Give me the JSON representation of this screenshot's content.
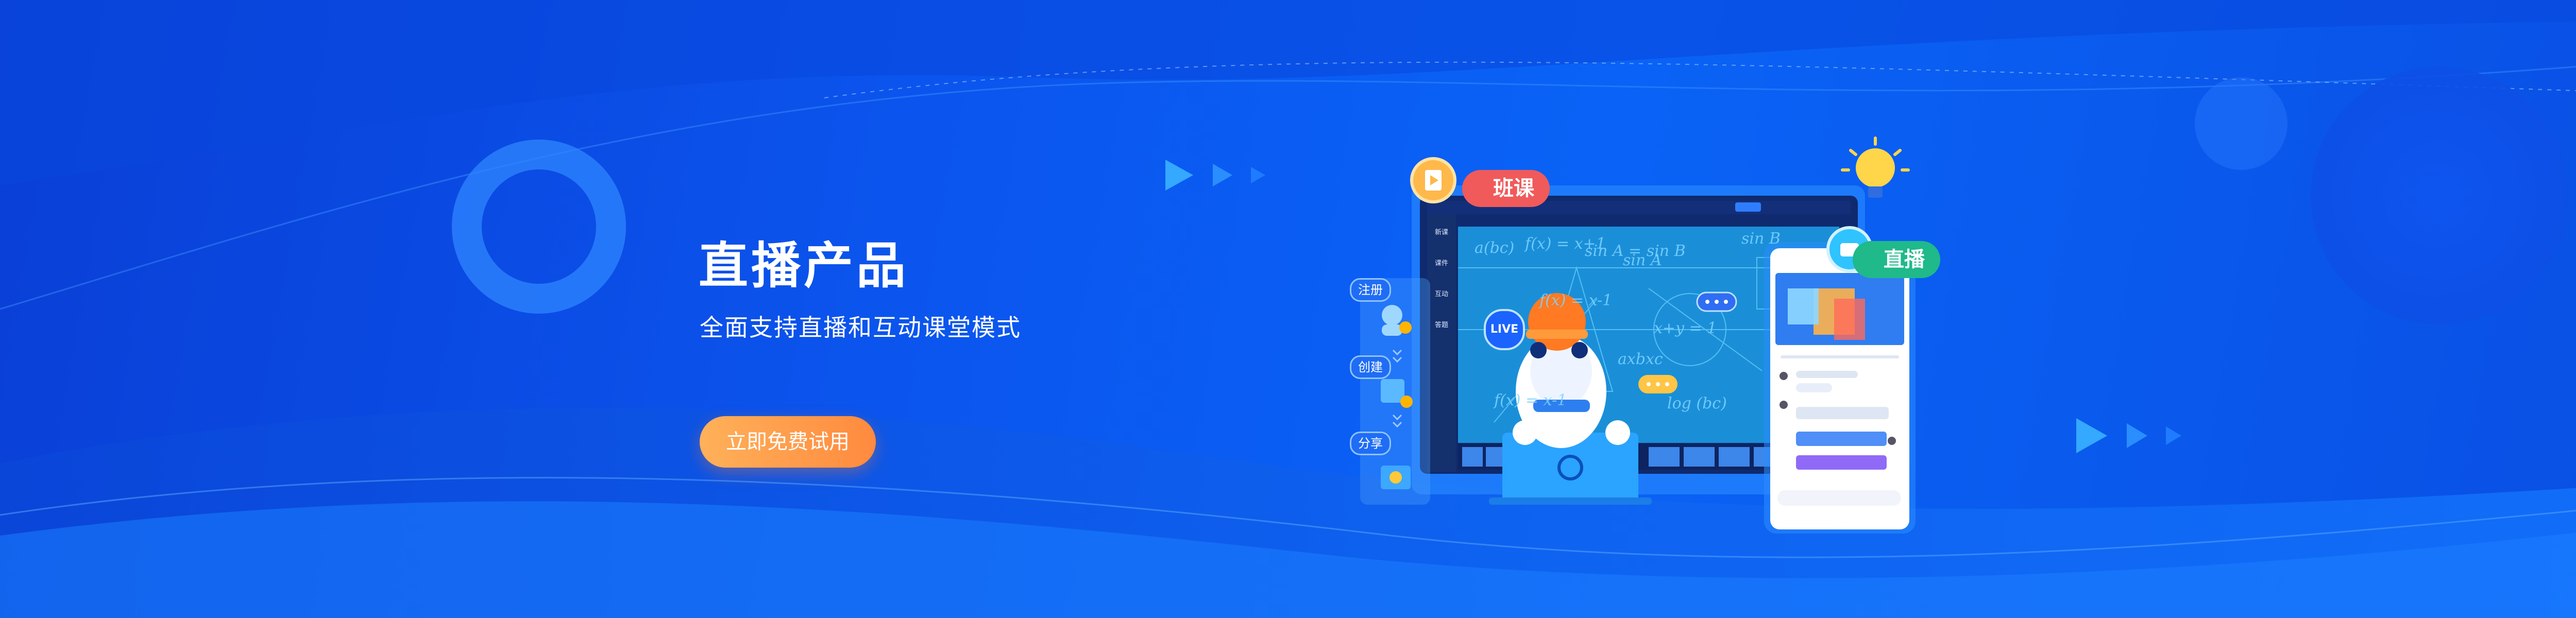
{
  "hero": {
    "title": "直播产品",
    "subtitle": "全面支持直播和互动课堂模式",
    "cta_label": "立即免费试用"
  },
  "illustration": {
    "tag_class_label": "班课",
    "tag_live_label": "直播",
    "steps": [
      "注册",
      "创建",
      "分享"
    ],
    "live_badge": "LIVE",
    "board_formulas": [
      "a(bc)",
      "f(x) = x+1",
      "sin A",
      "sin B",
      "f(x) = x-1",
      "x+y = 1",
      "axbxc",
      "log (bc)",
      "sin A = sin B",
      "f(x) = x-1"
    ],
    "side_menu": [
      "新课",
      "课件",
      "互动",
      "答题"
    ]
  },
  "colors": {
    "background_primary": "#0b55ee",
    "cta_start": "#ffb15a",
    "cta_end": "#ff8a3e",
    "tag_class": "#f05a5a",
    "tag_live": "#1fb98a"
  }
}
